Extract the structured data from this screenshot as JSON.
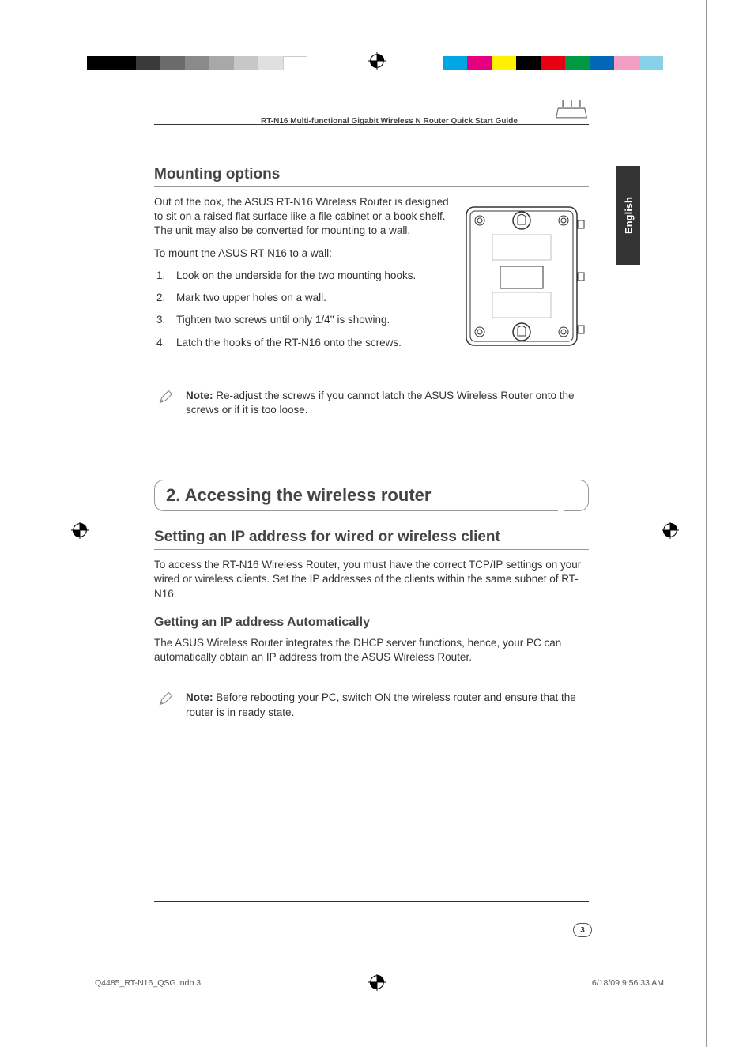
{
  "header": {
    "title": "RT-N16 Multi-functional Gigabit Wireless N Router Quick Start Guide"
  },
  "language_tab": "English",
  "mounting": {
    "title": "Mounting options",
    "intro": "Out of the box, the ASUS RT-N16 Wireless Router is designed to sit on a raised flat surface like a file cabinet or a book shelf. The unit may also be converted for mounting to a wall.",
    "prompt": "To mount the ASUS RT-N16 to a wall:",
    "steps": [
      "Look on the underside for the two mounting hooks.",
      "Mark two upper holes on a wall.",
      "Tighten two screws until only 1/4'' is showing.",
      "Latch the hooks of the RT-N16 onto the screws."
    ],
    "note_label": "Note:",
    "note_text": " Re-adjust the screws if you cannot latch the ASUS Wireless Router onto the screws or if it is too loose."
  },
  "chapter": {
    "title": "2. Accessing the wireless router"
  },
  "ip_section": {
    "title": "Setting an IP address for wired or wireless client",
    "body": "To access the RT-N16 Wireless Router, you must have the correct TCP/IP settings on your wired or wireless clients. Set the IP addresses of the clients within the same subnet of RT-N16."
  },
  "auto_ip": {
    "title": "Getting an IP address Automatically",
    "body": "The ASUS Wireless Router integrates the DHCP server functions, hence, your PC can automatically obtain an IP address from the ASUS Wireless Router.",
    "note_label": "Note:",
    "note_text": " Before rebooting your PC, switch ON the wireless router and ensure that the router is in ready state."
  },
  "footer": {
    "page": "3",
    "file": "Q4485_RT-N16_QSG.indb   3",
    "timestamp": "6/18/09   9:56:33 AM"
  },
  "colors": {
    "left_bars": [
      "#000",
      "#000",
      "#3a3a3a",
      "#6b6b6b",
      "#8a8a8a",
      "#a8a8a8",
      "#c7c7c7",
      "#e0e0e0",
      "#fff"
    ],
    "right_bars": [
      "#00a5e3",
      "#e4007f",
      "#fff100",
      "#000",
      "#e60012",
      "#009944",
      "#0068b7",
      "#f29fc5",
      "#87d0e8"
    ]
  }
}
